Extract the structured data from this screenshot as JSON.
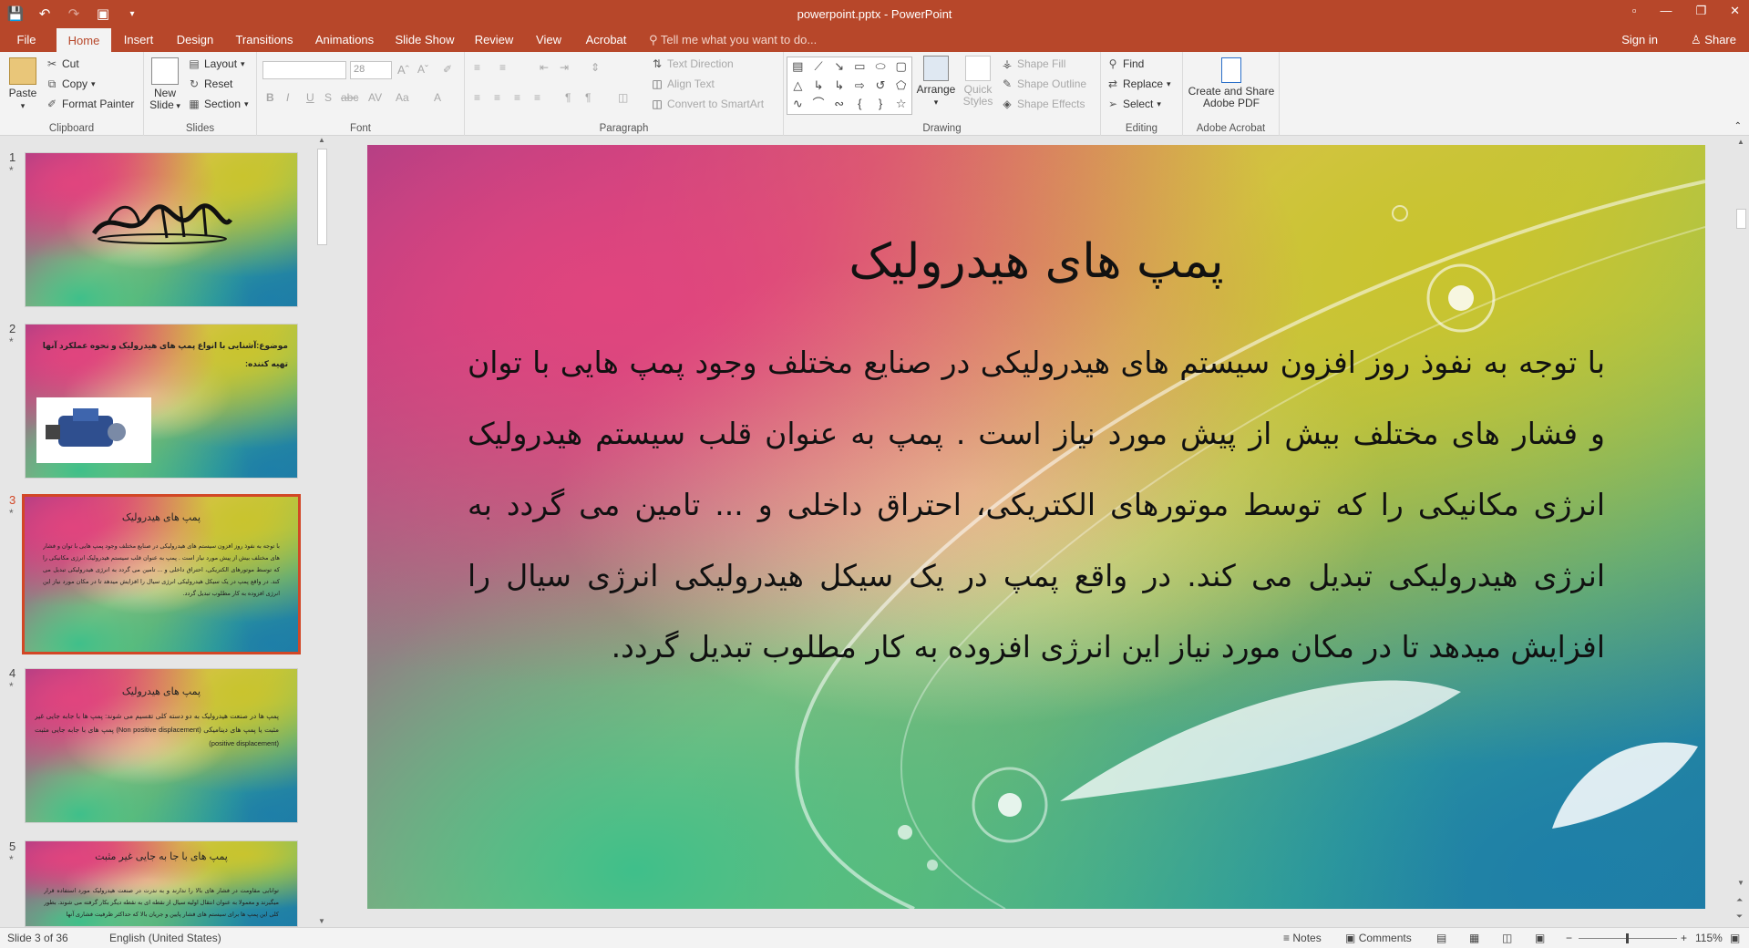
{
  "window": {
    "title": "powerpoint.pptx - PowerPoint"
  },
  "qat": {
    "save_icon": "save-icon",
    "undo_icon": "undo-icon",
    "redo_icon": "redo-icon",
    "present_icon": "present-icon"
  },
  "tabs": [
    {
      "label": "File"
    },
    {
      "label": "Home"
    },
    {
      "label": "Insert"
    },
    {
      "label": "Design"
    },
    {
      "label": "Transitions"
    },
    {
      "label": "Animations"
    },
    {
      "label": "Slide Show"
    },
    {
      "label": "Review"
    },
    {
      "label": "View"
    },
    {
      "label": "Acrobat"
    }
  ],
  "tell_me": "Tell me what you want to do...",
  "account": {
    "sign_in": "Sign in",
    "share": "Share"
  },
  "ribbon": {
    "clipboard": {
      "paste": "Paste",
      "cut": "Cut",
      "copy": "Copy",
      "format_painter": "Format Painter",
      "label": "Clipboard"
    },
    "slides": {
      "new_slide_1": "New",
      "new_slide_2": "Slide",
      "layout": "Layout",
      "reset": "Reset",
      "section": "Section",
      "label": "Slides"
    },
    "font": {
      "font_name": "",
      "font_size": "28",
      "label": "Font"
    },
    "paragraph": {
      "text_direction": "Text Direction",
      "align_text": "Align Text",
      "convert_smartart": "Convert to SmartArt",
      "label": "Paragraph"
    },
    "drawing": {
      "arrange": "Arrange",
      "quick_styles_1": "Quick",
      "quick_styles_2": "Styles",
      "shape_fill": "Shape Fill",
      "shape_outline": "Shape Outline",
      "shape_effects": "Shape Effects",
      "label": "Drawing"
    },
    "editing": {
      "find": "Find",
      "replace": "Replace",
      "select": "Select",
      "label": "Editing"
    },
    "acrobat": {
      "create_1": "Create and Share",
      "create_2": "Adobe PDF",
      "label": "Adobe Acrobat"
    }
  },
  "thumbnails": [
    {
      "num": "1",
      "star": "*",
      "title": "",
      "body": ""
    },
    {
      "num": "2",
      "star": "*",
      "title": "موضوع:آشنایی با انواع پمپ های هیدرولیک و نحوه عملکرد آنها",
      "subtitle": "تهیه کننده:",
      "body": ""
    },
    {
      "num": "3",
      "star": "*",
      "title": "پمپ های هیدرولیک",
      "body": "با توجه به نفوذ روز افزون سیستم های هیدرولیکی در صنایع مختلف وجود پمپ هایی با توان و فشار های مختلف بیش از پیش مورد نیاز است . پمپ به عنوان قلب سیستم هیدرولیک انرژی مکانیکی را که توسط موتورهای الکتریکی، احتراق داخلی و ... تامین می گردد به انرژی هیدرولیکی تبدیل می کند. در واقع پمپ در یک سیکل هیدرولیکی انرژی سیال را افزایش میدهد تا در مکان مورد نیاز این انرژی افزوده به کار مطلوب تبدیل گردد."
    },
    {
      "num": "4",
      "star": "*",
      "title": "پمپ های هیدرولیک",
      "body": "پمپ ها در صنعت هیدرولیک به دو دسته کلی تقسیم می شوند: پمپ ها با جابه جایی غیر مثبت یا پمپ های دینامیکی (Non positive displacement) پمپ های با جابه جایی مثبت (positive displacement)"
    },
    {
      "num": "5",
      "star": "*",
      "title": "پمپ های با جا به جایی غیر مثبت",
      "body": "توانایی مقاومت در فشار های بالا را ندارند و به ندرت در صنعت هیدرولیک مورد استفاده قرار میگیرند و معمولا به عنوان انتقال اولیه سیال از نقطه ای به نقطه دیگر بکار گرفته می شوند. بطور کلی این پمپ ها برای سیستم های فشار پایین و جریان بالا که حداکثر ظرفیت فشاری آنها"
    }
  ],
  "slide": {
    "title": "پمپ های هیدرولیک",
    "body": "با توجه به نفوذ روز افزون سیستم های هیدرولیکی در صنایع مختلف وجود پمپ هایی با توان و فشار های مختلف بیش از پیش مورد نیاز است . پمپ به عنوان قلب سیستم هیدرولیک انرژی مکانیکی را که توسط موتورهای الکتریکی، احتراق داخلی و ... تامین می گردد به انرژی هیدرولیکی تبدیل می کند. در واقع پمپ در یک سیکل هیدرولیکی انرژی سیال را افزایش میدهد تا در مکان مورد نیاز این انرژی افزوده به کار مطلوب تبدیل گردد."
  },
  "status": {
    "slide_count": "Slide 3 of 36",
    "language": "English (United States)",
    "notes": "Notes",
    "comments": "Comments",
    "zoom": "115%"
  },
  "colors": {
    "accent": "#b7472a",
    "selection": "#d24726"
  }
}
